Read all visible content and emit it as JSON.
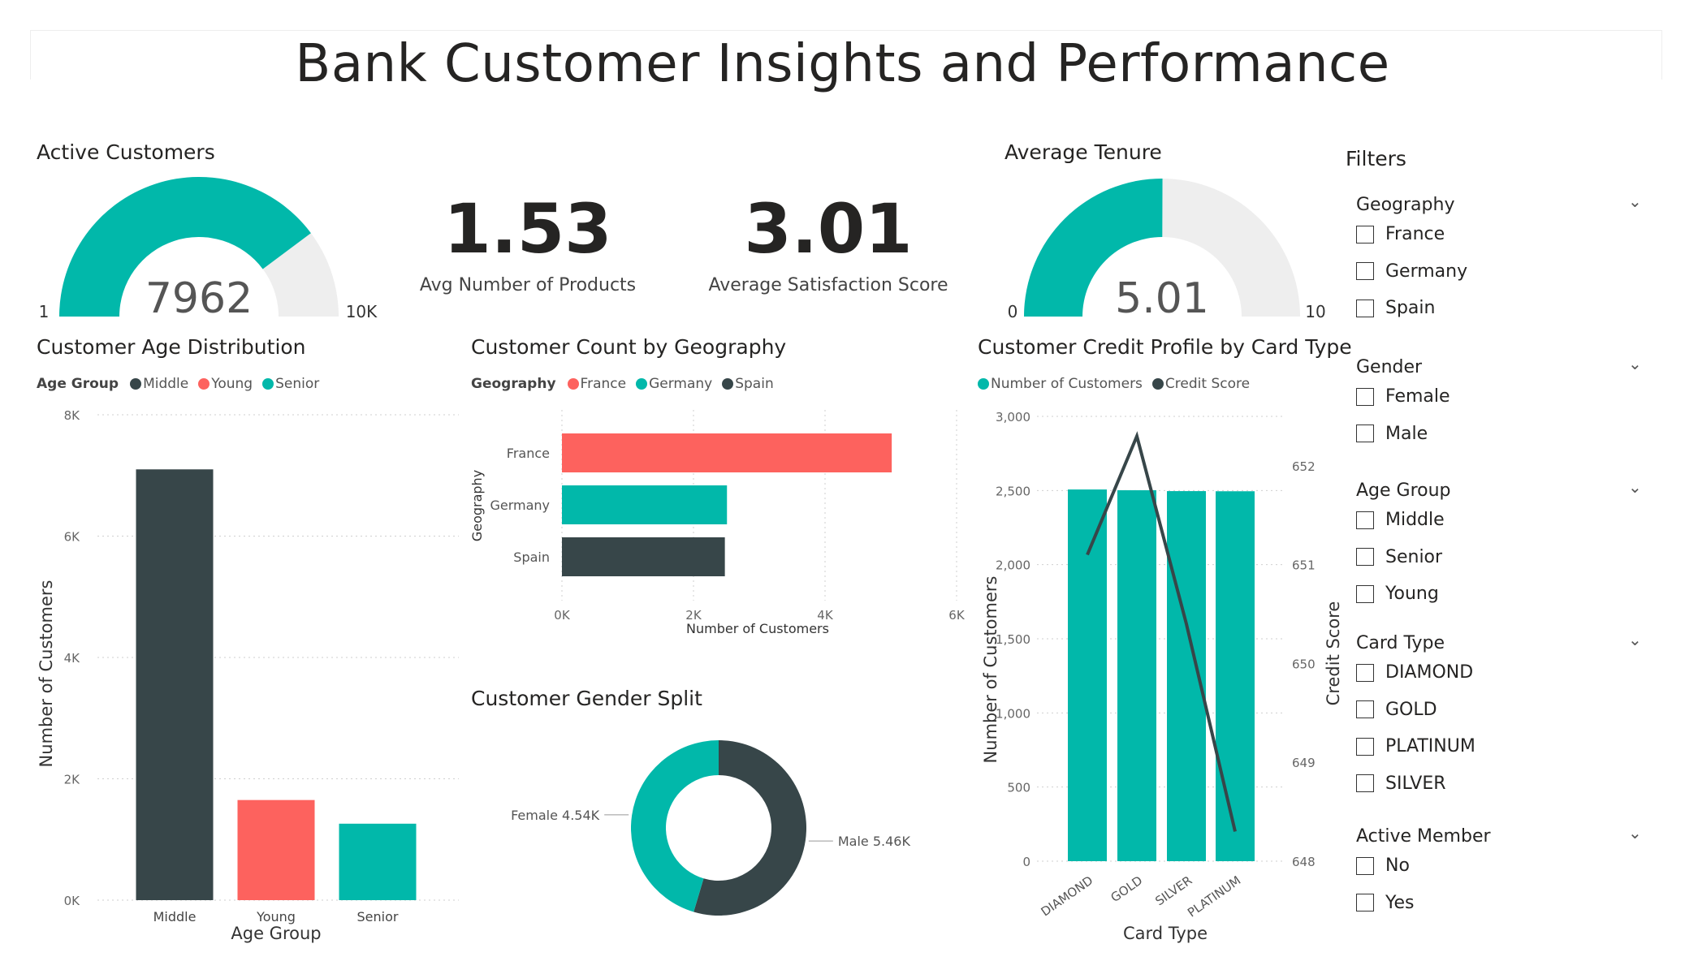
{
  "title": "Bank Customer Insights and Performance",
  "colors": {
    "teal": "#01B8AA",
    "dark": "#374649",
    "red": "#FD625E",
    "track": "#eeeeee"
  },
  "kpis": {
    "active_customers": {
      "title": "Active Customers",
      "value": 7962,
      "value_label": "7962",
      "min_label": "1",
      "max_label": "10K",
      "min": 1,
      "max": 10000
    },
    "avg_products": {
      "value": "1.53",
      "label": "Avg Number of Products"
    },
    "avg_satisfaction": {
      "value": "3.01",
      "label": "Average Satisfaction Score"
    },
    "avg_tenure": {
      "title": "Average Tenure",
      "value": 5.01,
      "value_label": "5.01",
      "min_label": "0",
      "max_label": "10",
      "min": 0,
      "max": 10
    }
  },
  "age_chart": {
    "title": "Customer Age Distribution",
    "legend_title": "Age Group",
    "xlabel": "Age Group",
    "ylabel": "Number of Customers"
  },
  "geo_chart": {
    "title": "Customer Count by Geography",
    "legend_title": "Geography",
    "xlabel": "Number of Customers",
    "ylabel": "Geography"
  },
  "gender_chart": {
    "title": "Customer Gender Split"
  },
  "card_chart": {
    "title": "Customer Credit Profile by Card Type",
    "xlabel": "Card Type",
    "ylabel_left": "Number of Customers",
    "ylabel_right": "Credit Score",
    "legend": [
      "Number of Customers",
      "Credit Score"
    ]
  },
  "chart_data": [
    {
      "type": "bar",
      "title": "Customer Age Distribution",
      "categories": [
        "Middle",
        "Young",
        "Senior"
      ],
      "values": [
        7100,
        1650,
        1260
      ],
      "colors": [
        "#374649",
        "#FD625E",
        "#01B8AA"
      ],
      "xlabel": "Age Group",
      "ylabel": "Number of Customers",
      "ylim": [
        0,
        8000
      ],
      "yticks": [
        "0K",
        "2K",
        "4K",
        "6K",
        "8K"
      ],
      "legend": [
        "Middle",
        "Young",
        "Senior"
      ],
      "grid": true
    },
    {
      "type": "bar",
      "orientation": "horizontal",
      "title": "Customer Count by Geography",
      "categories": [
        "France",
        "Germany",
        "Spain"
      ],
      "values": [
        5014,
        2509,
        2477
      ],
      "colors": [
        "#FD625E",
        "#01B8AA",
        "#374649"
      ],
      "xlabel": "Number of Customers",
      "ylabel": "Geography",
      "xlim": [
        0,
        6000
      ],
      "xticks": [
        "0K",
        "2K",
        "4K",
        "6K"
      ],
      "legend": [
        "France",
        "Germany",
        "Spain"
      ],
      "grid": true
    },
    {
      "type": "pie",
      "title": "Customer Gender Split",
      "donut": true,
      "categories": [
        "Male",
        "Female"
      ],
      "values": [
        5460,
        4540
      ],
      "labels": [
        "Male 5.46K",
        "Female 4.54K"
      ],
      "colors": [
        "#374649",
        "#01B8AA"
      ]
    },
    {
      "type": "bar",
      "title": "Customer Credit Profile by Card Type",
      "categories": [
        "DIAMOND",
        "GOLD",
        "SILVER",
        "PLATINUM"
      ],
      "series": [
        {
          "name": "Number of Customers",
          "kind": "bar",
          "values": [
            2507,
            2502,
            2496,
            2495
          ],
          "color": "#01B8AA"
        },
        {
          "name": "Credit Score",
          "kind": "line",
          "values": [
            651.1,
            652.3,
            650.4,
            648.3
          ],
          "color": "#374649"
        }
      ],
      "xlabel": "Card Type",
      "ylabel": "Number of Customers",
      "ylabel_right": "Credit Score",
      "ylim": [
        0,
        3000
      ],
      "yticks": [
        "0",
        "500",
        "1,000",
        "1,500",
        "2,000",
        "2,500",
        "3,000"
      ],
      "ylim_right": [
        648,
        652.5
      ],
      "yticks_right": [
        "648",
        "649",
        "650",
        "651",
        "652"
      ],
      "grid": true
    }
  ],
  "filters": {
    "title": "Filters",
    "groups": [
      {
        "label": "Geography",
        "options": [
          "France",
          "Germany",
          "Spain"
        ]
      },
      {
        "label": "Gender",
        "options": [
          "Female",
          "Male"
        ]
      },
      {
        "label": "Age Group",
        "options": [
          "Middle",
          "Senior",
          "Young"
        ]
      },
      {
        "label": "Card Type",
        "options": [
          "DIAMOND",
          "GOLD",
          "PLATINUM",
          "SILVER"
        ]
      },
      {
        "label": "Active Member",
        "options": [
          "No",
          "Yes"
        ]
      }
    ]
  }
}
